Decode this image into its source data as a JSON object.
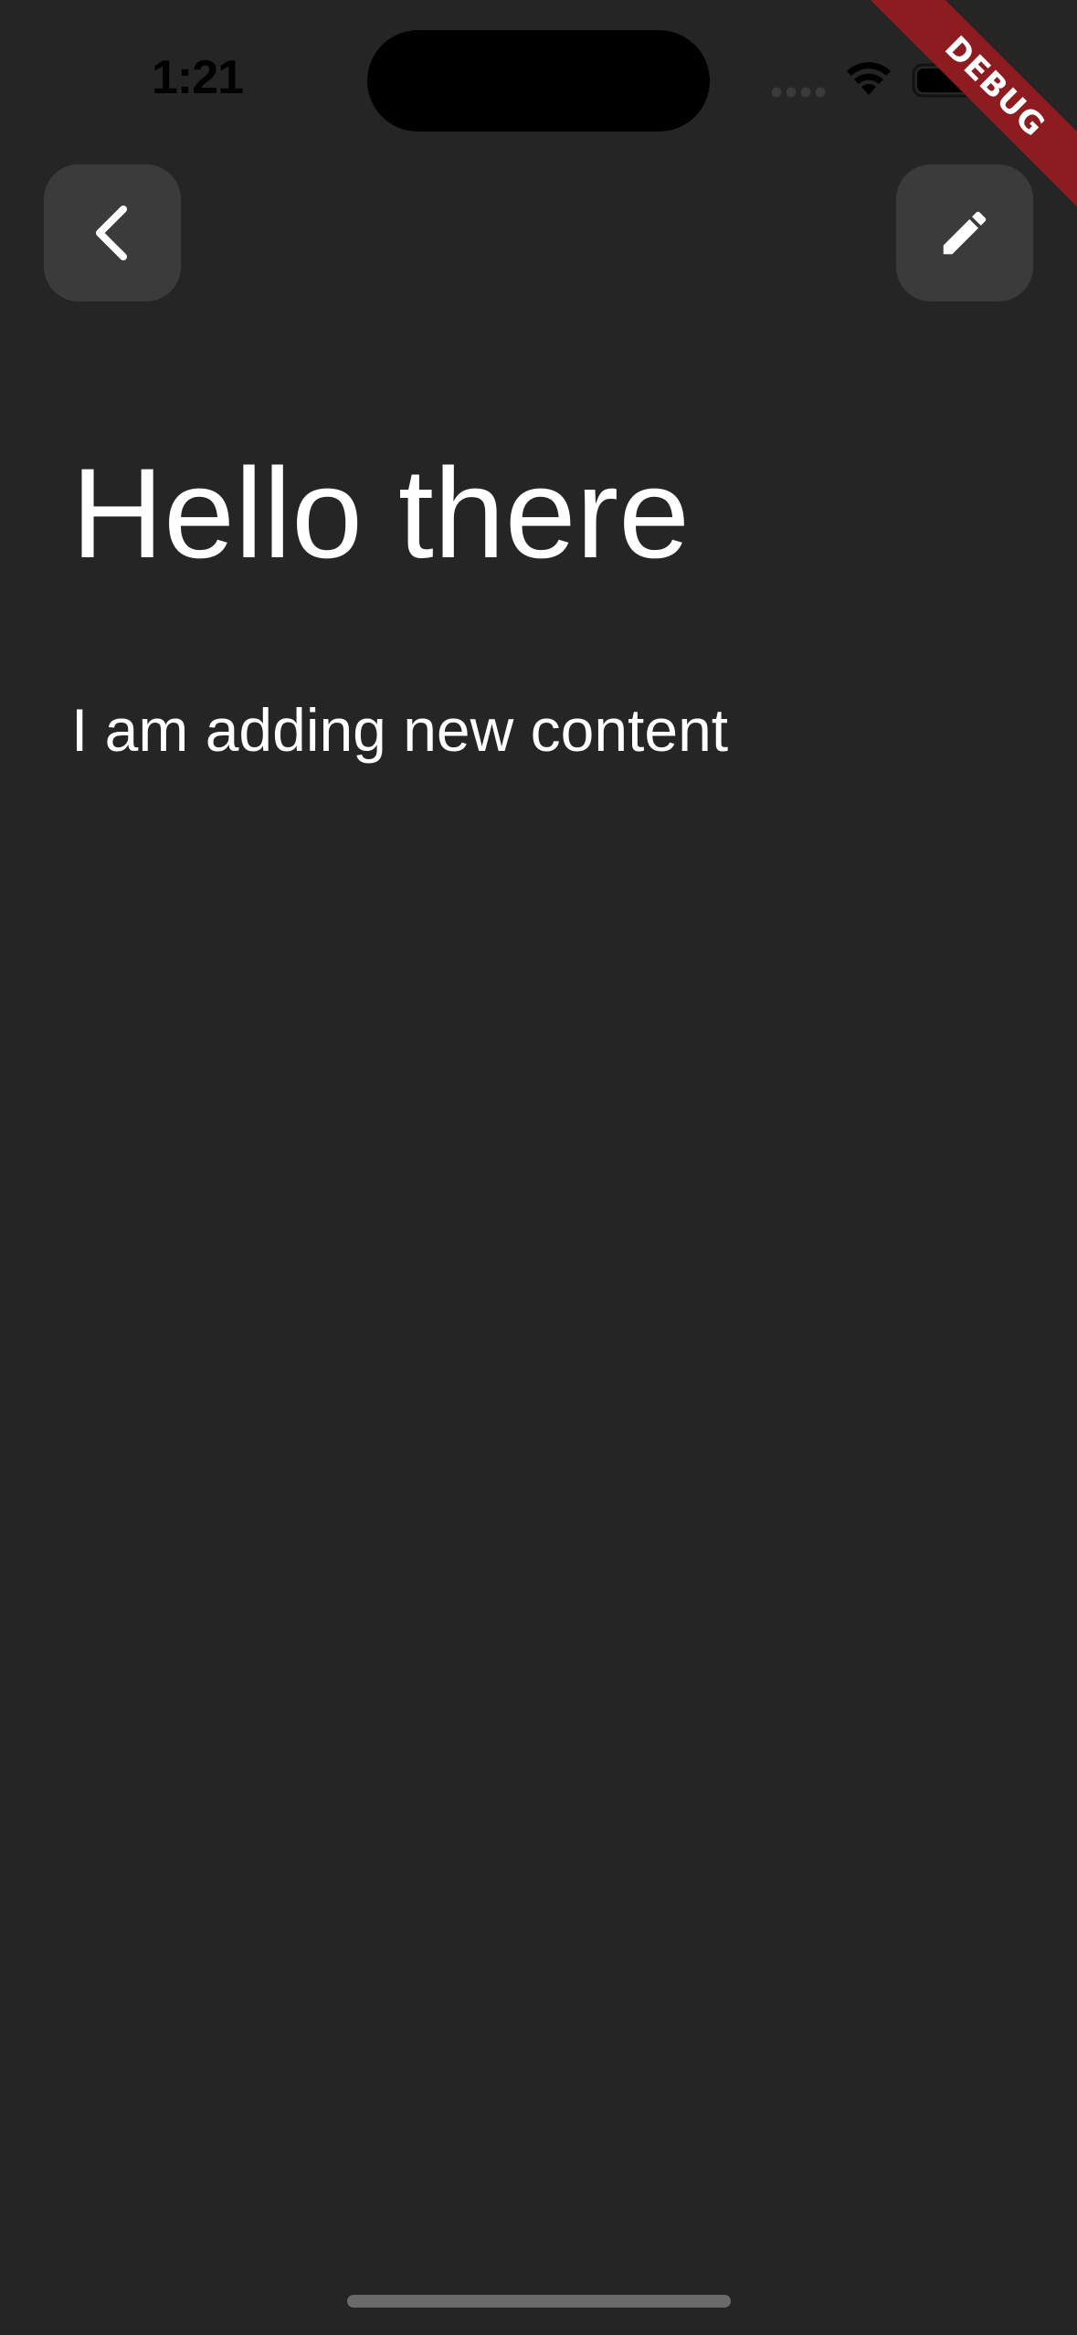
{
  "status_bar": {
    "time": "1:21"
  },
  "debug_banner": {
    "label": "DEBUG",
    "color": "#8e1b1f"
  },
  "toolbar": {
    "back_icon": "chevron-left-icon",
    "edit_icon": "pencil-icon",
    "button_color": "#3b3b3b"
  },
  "note": {
    "title": "Hello there",
    "content": "I am adding new content"
  },
  "theme": {
    "background": "#252525",
    "text": "#ffffff"
  }
}
